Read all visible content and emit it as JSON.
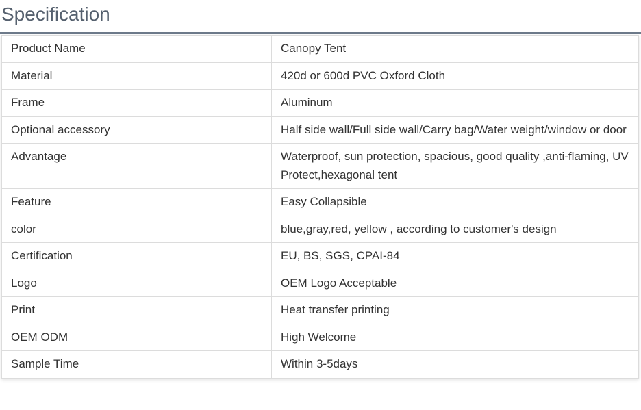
{
  "section": {
    "title": "Specification"
  },
  "spec_table": {
    "rows": [
      {
        "label": "Product Name",
        "value": "Canopy Tent"
      },
      {
        "label": "Material",
        "value": "420d or 600d PVC Oxford Cloth"
      },
      {
        "label": "Frame",
        "value": "Aluminum"
      },
      {
        "label": "Optional accessory",
        "value": "Half side wall/Full side wall/Carry bag/Water weight/window or door"
      },
      {
        "label": "Advantage",
        "value": "Waterproof, sun protection, spacious, good quality ,anti-flaming, UV Protect,hexagonal tent"
      },
      {
        "label": "Feature",
        "value": "Easy Collapsible"
      },
      {
        "label": "color",
        "value": "blue,gray,red, yellow , according to customer's design"
      },
      {
        "label": "Certification",
        "value": "EU, BS, SGS, CPAI-84"
      },
      {
        "label": "Logo",
        "value": "OEM Logo Acceptable"
      },
      {
        "label": "Print",
        "value": "Heat transfer printing"
      },
      {
        "label": "OEM ODM",
        "value": "High Welcome"
      },
      {
        "label": "Sample Time",
        "value": "Within 3-5days"
      }
    ]
  },
  "colors": {
    "heading_text": "#55606e",
    "heading_rule": "#6d7a8a",
    "table_border": "#dcdcdc",
    "cell_text": "#333333"
  }
}
